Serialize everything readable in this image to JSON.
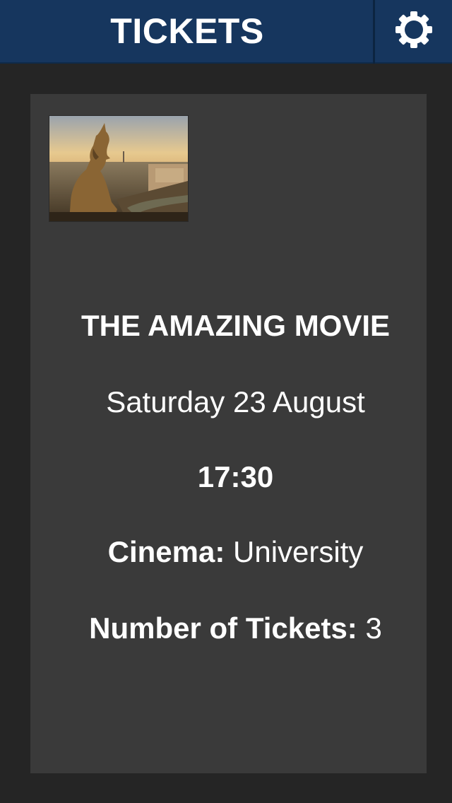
{
  "header": {
    "title": "TICKETS",
    "settings_icon": "gear-icon",
    "background_color": "#16365e"
  },
  "ticket": {
    "image_icon": "movie-poster-image",
    "title": "THE AMAZING MOVIE",
    "date": "Saturday 23 August",
    "time": "17:30",
    "cinema_label": "Cinema:",
    "cinema_value": "University",
    "tickets_label": "Number of Tickets:",
    "tickets_value": "3"
  },
  "colors": {
    "page_background": "#252525",
    "card_background": "#3a3a3a",
    "text": "#ffffff"
  }
}
